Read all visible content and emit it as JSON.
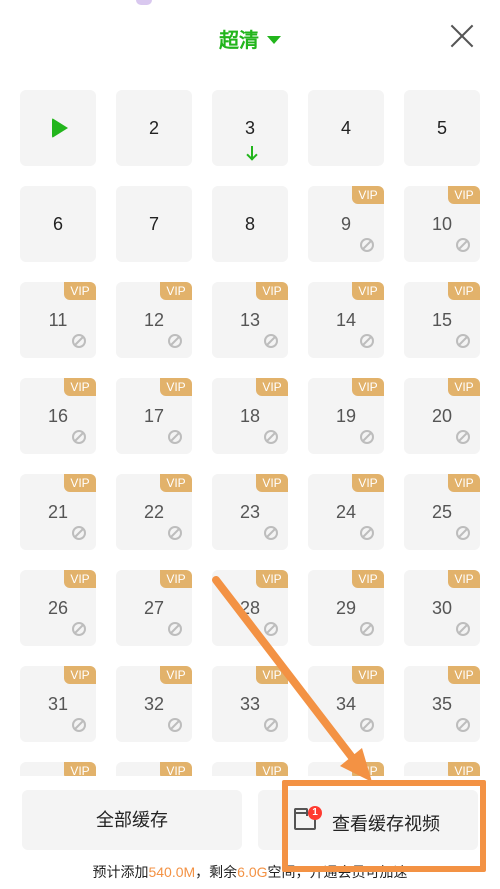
{
  "header": {
    "quality_label": "超清"
  },
  "episodes": [
    {
      "num": "",
      "state": "playing"
    },
    {
      "num": "2",
      "state": "normal"
    },
    {
      "num": "3",
      "state": "downloading"
    },
    {
      "num": "4",
      "state": "normal"
    },
    {
      "num": "5",
      "state": "normal"
    },
    {
      "num": "6",
      "state": "normal"
    },
    {
      "num": "7",
      "state": "normal"
    },
    {
      "num": "8",
      "state": "normal"
    },
    {
      "num": "9",
      "state": "vip"
    },
    {
      "num": "10",
      "state": "vip"
    },
    {
      "num": "11",
      "state": "vip"
    },
    {
      "num": "12",
      "state": "vip"
    },
    {
      "num": "13",
      "state": "vip"
    },
    {
      "num": "14",
      "state": "vip"
    },
    {
      "num": "15",
      "state": "vip"
    },
    {
      "num": "16",
      "state": "vip"
    },
    {
      "num": "17",
      "state": "vip"
    },
    {
      "num": "18",
      "state": "vip"
    },
    {
      "num": "19",
      "state": "vip"
    },
    {
      "num": "20",
      "state": "vip"
    },
    {
      "num": "21",
      "state": "vip"
    },
    {
      "num": "22",
      "state": "vip"
    },
    {
      "num": "23",
      "state": "vip"
    },
    {
      "num": "24",
      "state": "vip"
    },
    {
      "num": "25",
      "state": "vip"
    },
    {
      "num": "26",
      "state": "vip"
    },
    {
      "num": "27",
      "state": "vip"
    },
    {
      "num": "28",
      "state": "vip"
    },
    {
      "num": "29",
      "state": "vip"
    },
    {
      "num": "30",
      "state": "vip"
    },
    {
      "num": "31",
      "state": "vip"
    },
    {
      "num": "32",
      "state": "vip"
    },
    {
      "num": "33",
      "state": "vip"
    },
    {
      "num": "34",
      "state": "vip"
    },
    {
      "num": "35",
      "state": "vip"
    },
    {
      "num": "",
      "state": "vip"
    },
    {
      "num": "",
      "state": "vip"
    },
    {
      "num": "",
      "state": "vip"
    },
    {
      "num": "",
      "state": "vip"
    },
    {
      "num": "",
      "state": "vip"
    }
  ],
  "vip_label": "VIP",
  "actions": {
    "cache_all_label": "全部缓存",
    "view_cache_label": "查看缓存视频",
    "view_cache_badge": "1"
  },
  "storage": {
    "prefix": "预计添加",
    "added": "540.0M",
    "middle": "，剩余",
    "remaining": "6.0G",
    "suffix": "空间，开通会员可加速"
  },
  "colors": {
    "accent_green": "#22b51c",
    "vip_gold": "#e2b26b",
    "annotation_orange": "#f39244"
  }
}
